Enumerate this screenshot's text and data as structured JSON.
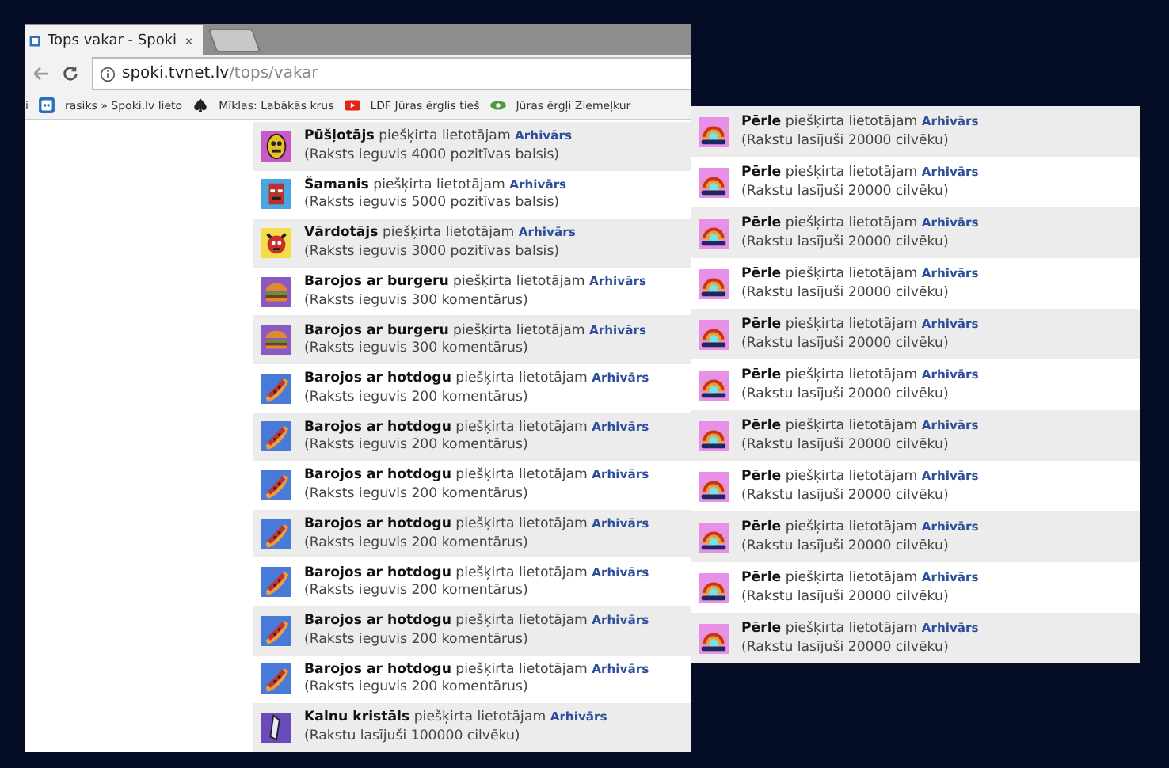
{
  "browser": {
    "tabs": [
      {
        "title": "Tops vakar - Spoki",
        "selected": true
      }
    ],
    "address": {
      "host": "spoki.tvnet.lv",
      "path": "/tops/vakar"
    },
    "bookmarks": [
      {
        "label": "i",
        "kind": "text"
      },
      {
        "label": "rasiks » Spoki.lv lieto",
        "kind": "spoki"
      },
      {
        "label": "Mīklas: Labākās krus",
        "kind": "spade"
      },
      {
        "label": "LDF Jūras ērglis tieš",
        "kind": "video"
      },
      {
        "label": "Jūras ērgļi Ziemeļkur",
        "kind": "eye"
      }
    ]
  },
  "left_awards": [
    {
      "kind": "yellow-mask",
      "text": "**Pūšļotājs** piešķirta lietotājam",
      "user": "Arhivārs",
      "detail": "(Raksts ieguvis 4000 pozitīvas balsis)"
    },
    {
      "kind": "shaman",
      "text": "**Šamanis** piešķirta lietotājam",
      "user": "Arhivārs",
      "detail": "(Raksts ieguvis 5000 pozitīvas balsis)"
    },
    {
      "kind": "red-mask",
      "text": "**Vārdotājs** piešķirta lietotājam",
      "user": "Arhivārs",
      "detail": "(Raksts ieguvis 3000 pozitīvas balsis)"
    },
    {
      "kind": "burger",
      "text": "**Barojos ar burgeru** piešķirta lietotājam",
      "user": "Arhivārs",
      "detail": "(Raksts ieguvis 300 komentārus)"
    },
    {
      "kind": "burger",
      "text": "**Barojos ar burgeru** piešķirta lietotājam",
      "user": "Arhivārs",
      "detail": "(Raksts ieguvis 300 komentārus)"
    },
    {
      "kind": "hotdog",
      "text": "**Barojos ar hotdogu** piešķirta lietotājam",
      "user": "Arhivārs",
      "detail": "(Raksts ieguvis 200 komentārus)"
    },
    {
      "kind": "hotdog",
      "text": "**Barojos ar hotdogu** piešķirta lietotājam",
      "user": "Arhivārs",
      "detail": "(Raksts ieguvis 200 komentārus)"
    },
    {
      "kind": "hotdog",
      "text": "**Barojos ar hotdogu** piešķirta lietotājam",
      "user": "Arhivārs",
      "detail": "(Raksts ieguvis 200 komentārus)"
    },
    {
      "kind": "hotdog",
      "text": "**Barojos ar hotdogu** piešķirta lietotājam",
      "user": "Arhivārs",
      "detail": "(Raksts ieguvis 200 komentārus)"
    },
    {
      "kind": "hotdog",
      "text": "**Barojos ar hotdogu** piešķirta lietotājam",
      "user": "Arhivārs",
      "detail": "(Raksts ieguvis 200 komentārus)"
    },
    {
      "kind": "hotdog",
      "text": "**Barojos ar hotdogu** piešķirta lietotājam",
      "user": "Arhivārs",
      "detail": "(Raksts ieguvis 200 komentārus)"
    },
    {
      "kind": "hotdog",
      "text": "**Barojos ar hotdogu** piešķirta lietotājam",
      "user": "Arhivārs",
      "detail": "(Raksts ieguvis 200 komentārus)"
    },
    {
      "kind": "crystal",
      "text": "**Kalnu kristāls** piešķirta lietotājam",
      "user": "Arhivārs",
      "detail": "(Rakstu lasījuši 100000 cilvēku)"
    }
  ],
  "right_awards": [
    {
      "kind": "pearl",
      "text": "**Pērle** piešķirta lietotājam",
      "user": "Arhivārs",
      "detail": "(Rakstu lasījuši 20000 cilvēku)"
    },
    {
      "kind": "pearl",
      "text": "**Pērle** piešķirta lietotājam",
      "user": "Arhivārs",
      "detail": "(Rakstu lasījuši 20000 cilvēku)"
    },
    {
      "kind": "pearl",
      "text": "**Pērle** piešķirta lietotājam",
      "user": "Arhivārs",
      "detail": "(Rakstu lasījuši 20000 cilvēku)"
    },
    {
      "kind": "pearl",
      "text": "**Pērle** piešķirta lietotājam",
      "user": "Arhivārs",
      "detail": "(Rakstu lasījuši 20000 cilvēku)"
    },
    {
      "kind": "pearl",
      "text": "**Pērle** piešķirta lietotājam",
      "user": "Arhivārs",
      "detail": "(Rakstu lasījuši 20000 cilvēku)"
    },
    {
      "kind": "pearl",
      "text": "**Pērle** piešķirta lietotājam",
      "user": "Arhivārs",
      "detail": "(Rakstu lasījuši 20000 cilvēku)"
    },
    {
      "kind": "pearl",
      "text": "**Pērle** piešķirta lietotājam",
      "user": "Arhivārs",
      "detail": "(Rakstu lasījuši 20000 cilvēku)"
    },
    {
      "kind": "pearl",
      "text": "**Pērle** piešķirta lietotājam",
      "user": "Arhivārs",
      "detail": "(Rakstu lasījuši 20000 cilvēku)"
    },
    {
      "kind": "pearl",
      "text": "**Pērle** piešķirta lietotājam",
      "user": "Arhivārs",
      "detail": "(Rakstu lasījuši 20000 cilvēku)"
    },
    {
      "kind": "pearl",
      "text": "**Pērle** piešķirta lietotājam",
      "user": "Arhivārs",
      "detail": "(Rakstu lasījuši 20000 cilvēku)"
    },
    {
      "kind": "pearl",
      "text": "**Pērle** piešķirta lietotājam",
      "user": "Arhivārs",
      "detail": "(Rakstu lasījuši 20000 cilvēku)"
    }
  ]
}
